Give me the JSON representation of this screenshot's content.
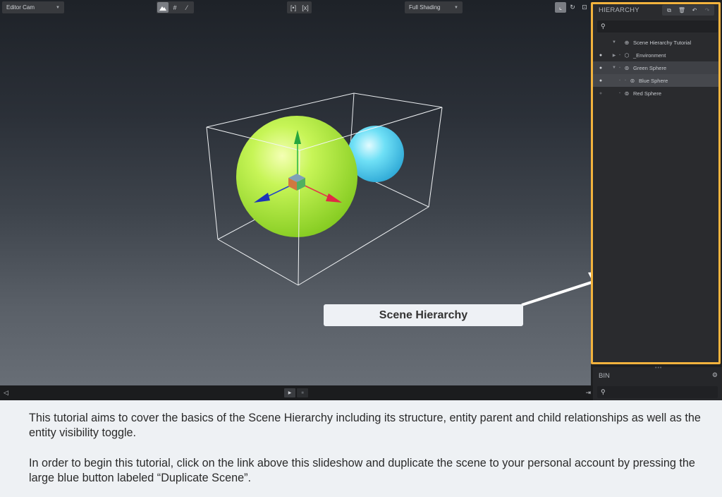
{
  "toolbar": {
    "camera": "Editor Cam",
    "shading": "Full Shading",
    "center_left": "[•]",
    "center_right": "[x]"
  },
  "hierarchy": {
    "title": "HIERARCHY",
    "items": [
      {
        "label": "Scene Hierarchy Tutorial",
        "icon": "globe-icon"
      },
      {
        "label": "_Environment",
        "icon": "hexagon-icon",
        "visible": true
      },
      {
        "label": "Green Sphere",
        "icon": "entity-icon",
        "visible": true
      },
      {
        "label": "Blue Sphere",
        "icon": "entity-icon",
        "visible": true
      },
      {
        "label": "Red Sphere",
        "icon": "entity-icon",
        "visible": false
      }
    ]
  },
  "bin": {
    "title": "BIN"
  },
  "callout": {
    "label": "Scene Hierarchy"
  },
  "description": {
    "p1": "This tutorial aims to cover the basics of the Scene Hierarchy including its structure, entity parent and child relationships as well as the entity visibility toggle.",
    "p2": "In order to begin this tutorial, click on the link above this slideshow and duplicate the scene to your personal account by pressing the large blue button labeled “Duplicate Scene”."
  },
  "colors": {
    "highlight_border": "#f3b33d",
    "green_sphere": "#b8f04a",
    "blue_sphere": "#5ad8f2"
  }
}
